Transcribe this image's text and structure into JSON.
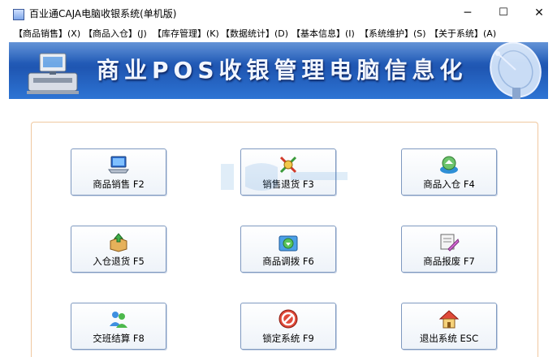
{
  "window": {
    "title": "百业通CAJA电脑收银系统(单机版)",
    "minimize": "─",
    "maximize": "☐",
    "close": "✕"
  },
  "menu": [
    {
      "label": "【商品销售】(X)"
    },
    {
      "label": "【商品入仓】(J)"
    },
    {
      "label": "【库存管理】(K)"
    },
    {
      "label": "【数据统计】(D)"
    },
    {
      "label": "【基本信息】(I)"
    },
    {
      "label": "【系统维护】(S)"
    },
    {
      "label": "【关于系统】(A)"
    }
  ],
  "banner": {
    "title": "商业POS收银管理电脑信息化"
  },
  "buttons": [
    {
      "label": "商品销售 F2",
      "icon": "laptop-icon"
    },
    {
      "label": "销售退货 F3",
      "icon": "return-icon"
    },
    {
      "label": "商品入仓 F4",
      "icon": "warehouse-in-icon"
    },
    {
      "label": "入仓退货 F5",
      "icon": "box-return-icon"
    },
    {
      "label": "商品调拨 F6",
      "icon": "transfer-icon"
    },
    {
      "label": "商品报废 F7",
      "icon": "scrap-icon"
    },
    {
      "label": "交班结算 F8",
      "icon": "users-icon"
    },
    {
      "label": "锁定系统 F9",
      "icon": "lock-icon"
    },
    {
      "label": "退出系统 ESC",
      "icon": "home-exit-icon"
    }
  ]
}
